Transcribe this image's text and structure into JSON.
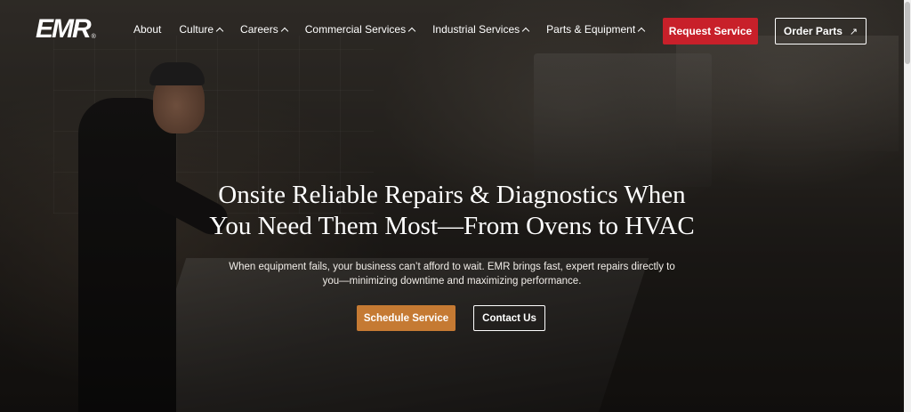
{
  "brand": {
    "logo_text": "EMR",
    "logo_mark": "®"
  },
  "nav": {
    "items": [
      {
        "label": "About",
        "has_dropdown": false
      },
      {
        "label": "Culture",
        "has_dropdown": true
      },
      {
        "label": "Careers",
        "has_dropdown": true
      },
      {
        "label": "Commercial Services",
        "has_dropdown": true
      },
      {
        "label": "Industrial Services",
        "has_dropdown": true
      },
      {
        "label": "Parts & Equipment",
        "has_dropdown": true
      }
    ],
    "request_label": "Request Service",
    "order_label": "Order Parts",
    "order_icon": "external-arrow-icon"
  },
  "hero": {
    "headline_line1": "Onsite Reliable Repairs & Diagnostics When",
    "headline_line2": "You Need Them Most—From Ovens to HVAC",
    "subtext_line1": "When equipment fails, your business can’t afford to wait. EMR brings fast, expert repairs directly to",
    "subtext_line2": "you—minimizing downtime and maximizing performance.",
    "primary_cta": "Schedule Service",
    "secondary_cta": "Contact Us"
  },
  "colors": {
    "request_button": "#c8202a",
    "schedule_button": "#c57a33",
    "text": "#ffffff"
  }
}
